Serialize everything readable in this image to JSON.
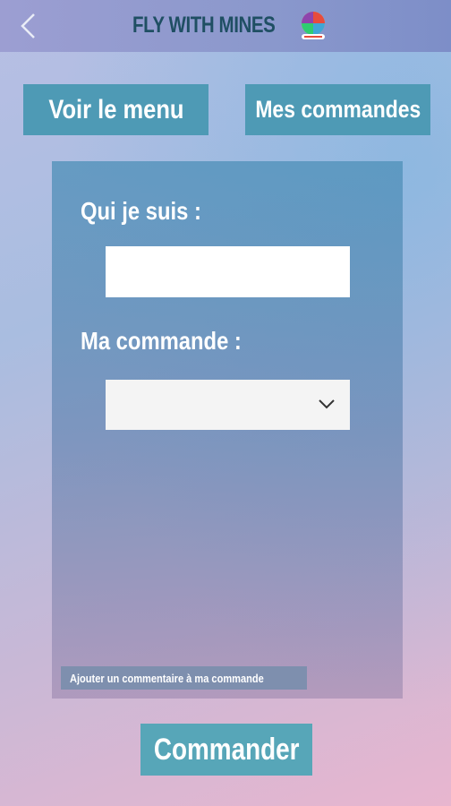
{
  "header": {
    "title": "FLY WITH MINES",
    "back_icon": "chevron-left-icon",
    "logo_icon": "hot-air-balloon-logo"
  },
  "top_buttons": {
    "menu_label": "Voir le menu",
    "orders_label": "Mes commandes"
  },
  "form": {
    "who_label": "Qui je suis :",
    "who_value": "",
    "order_label": "Ma commande :",
    "order_selected": "",
    "comment_link": "Ajouter un commentaire à ma commande"
  },
  "submit_label": "Commander",
  "colors": {
    "header_bg": "#8a98cc",
    "title_color": "#1f4f63",
    "button_bg": "#4e9ab5",
    "submit_bg": "#57a6b8"
  }
}
